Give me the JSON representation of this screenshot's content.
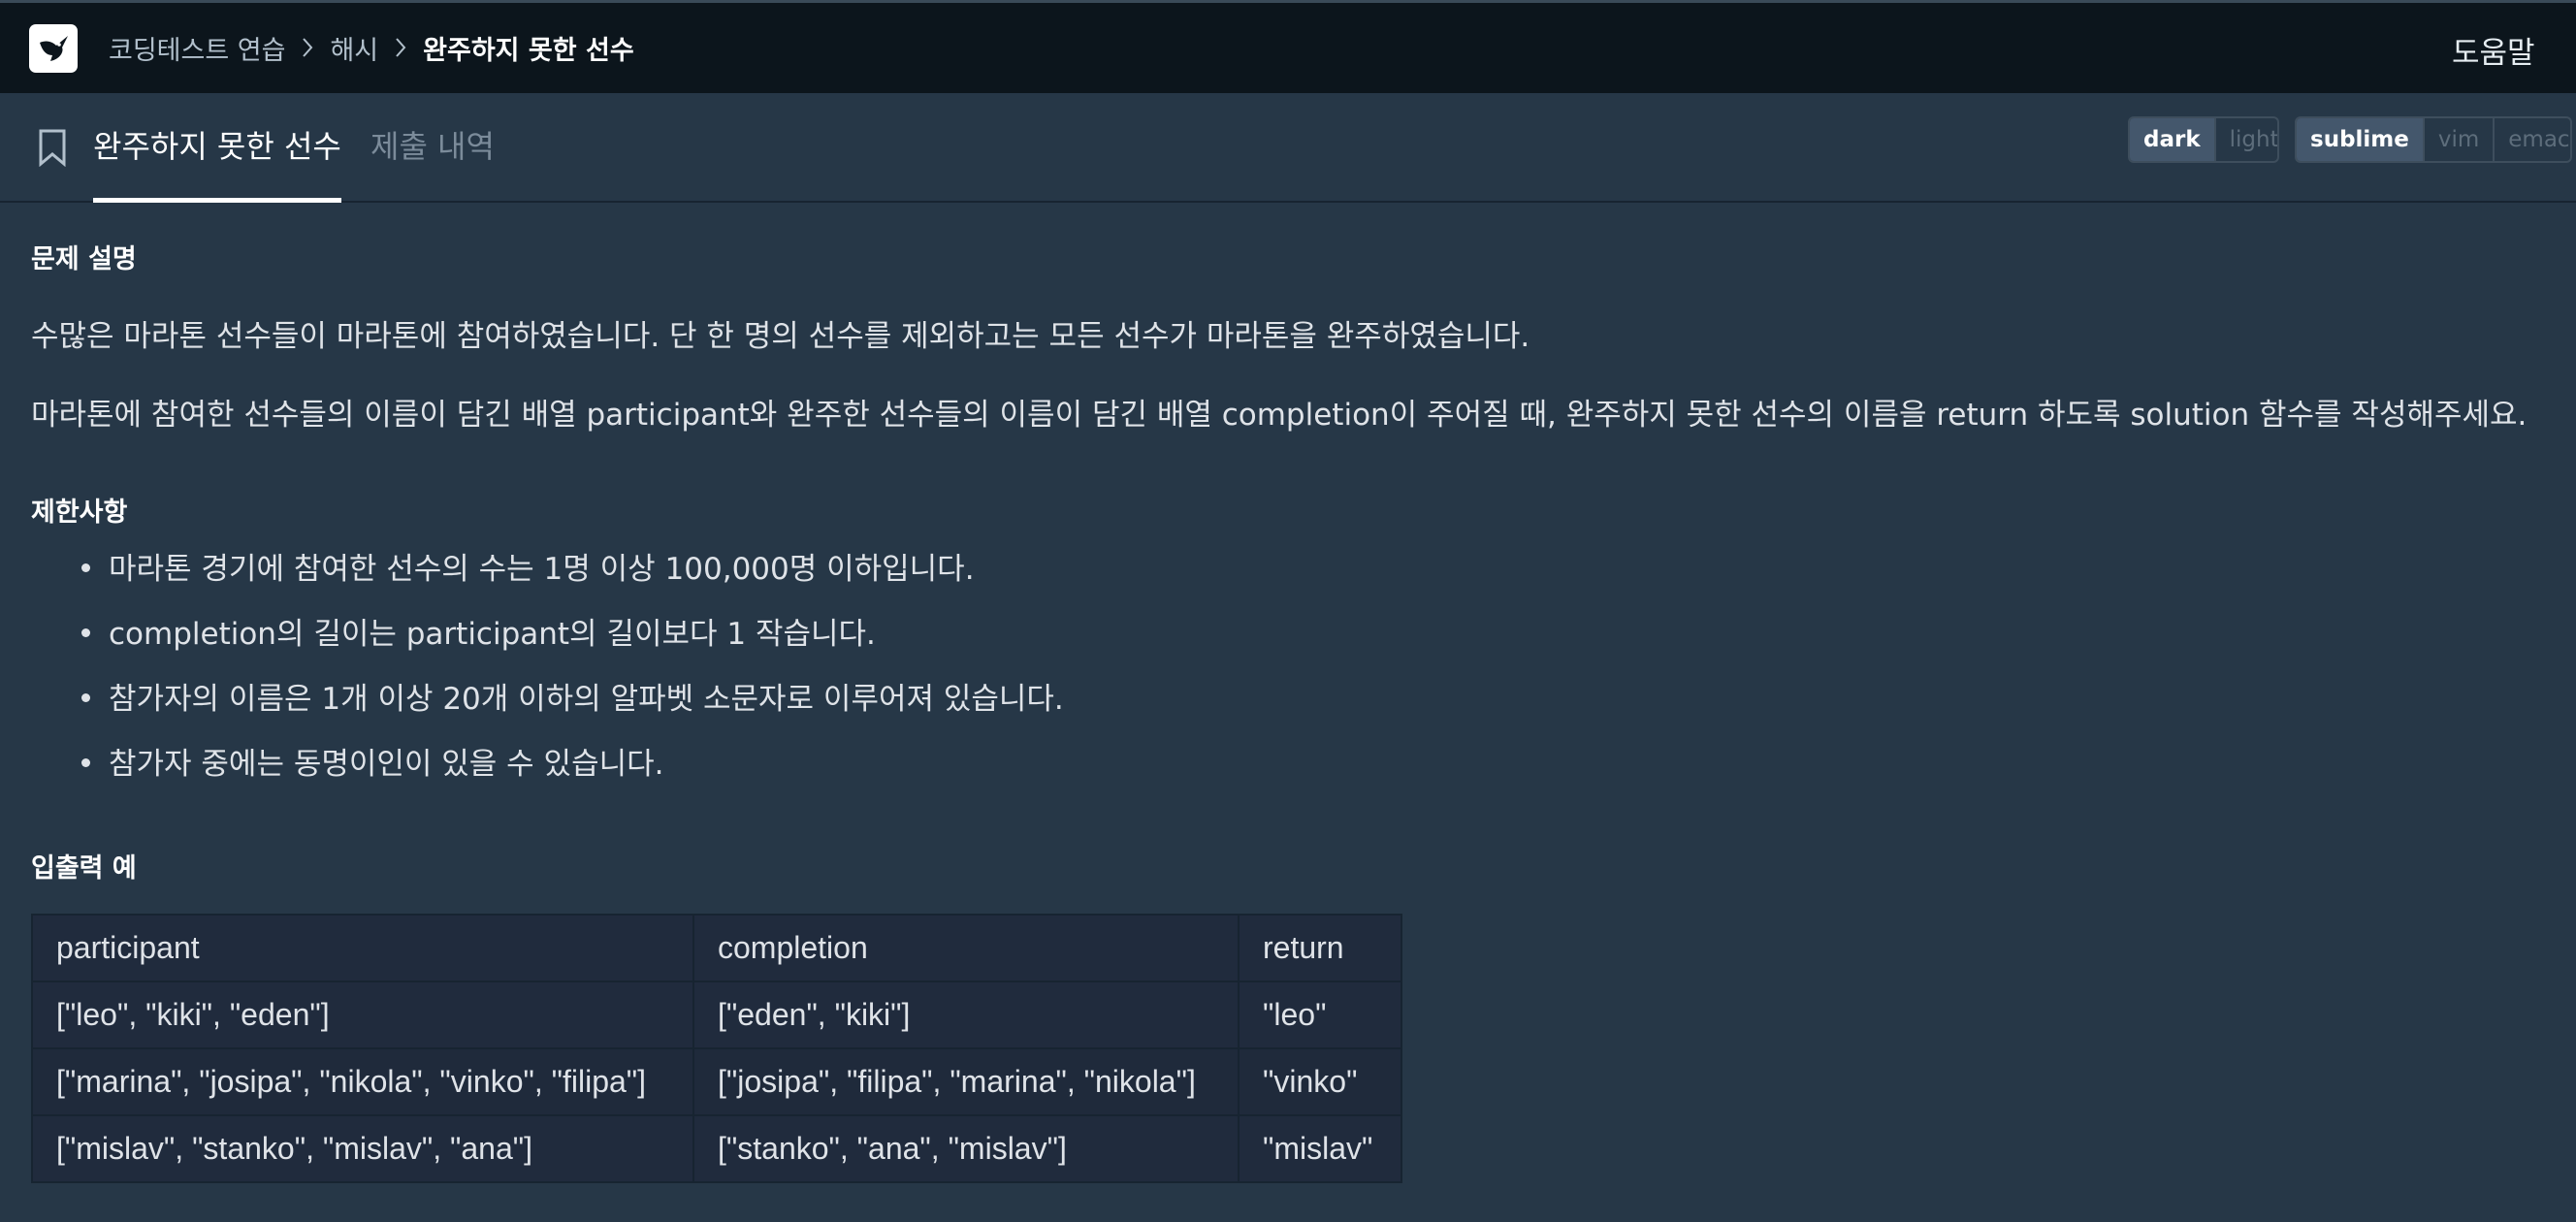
{
  "breadcrumb": {
    "items": [
      "코딩테스트 연습",
      "해시"
    ],
    "current": "완주하지 못한 선수"
  },
  "header": {
    "help_label": "도움말"
  },
  "tabs": {
    "active": "완주하지 못한 선수",
    "inactive": "제출 내역"
  },
  "theme_options": [
    "dark",
    "light"
  ],
  "theme_selected": "dark",
  "editor_options": [
    "sublime",
    "vim",
    "emacs"
  ],
  "editor_selected": "sublime",
  "problem": {
    "desc_title": "문제 설명",
    "desc_p1": "수많은 마라톤 선수들이 마라톤에 참여하였습니다. 단 한 명의 선수를 제외하고는 모든 선수가 마라톤을 완주하였습니다.",
    "desc_p2": "마라톤에 참여한 선수들의 이름이 담긴 배열 participant와 완주한 선수들의 이름이 담긴 배열 completion이 주어질 때, 완주하지 못한 선수의 이름을 return 하도록 solution 함수를 작성해주세요.",
    "constraints_title": "제한사항",
    "constraints": [
      "마라톤 경기에 참여한 선수의 수는 1명 이상 100,000명 이하입니다.",
      "completion의 길이는 participant의 길이보다 1 작습니다.",
      "참가자의 이름은 1개 이상 20개 이하의 알파벳 소문자로 이루어져 있습니다.",
      "참가자 중에는 동명이인이 있을 수 있습니다."
    ],
    "examples_title": "입출력 예",
    "table": {
      "headers": [
        "participant",
        "completion",
        "return"
      ],
      "rows": [
        [
          "[\"leo\", \"kiki\", \"eden\"]",
          "[\"eden\", \"kiki\"]",
          "\"leo\""
        ],
        [
          "[\"marina\", \"josipa\", \"nikola\", \"vinko\", \"filipa\"]",
          "[\"josipa\", \"filipa\", \"marina\", \"nikola\"]",
          "\"vinko\""
        ],
        [
          "[\"mislav\", \"stanko\", \"mislav\", \"ana\"]",
          "[\"stanko\", \"ana\", \"mislav\"]",
          "\"mislav\""
        ]
      ]
    }
  }
}
